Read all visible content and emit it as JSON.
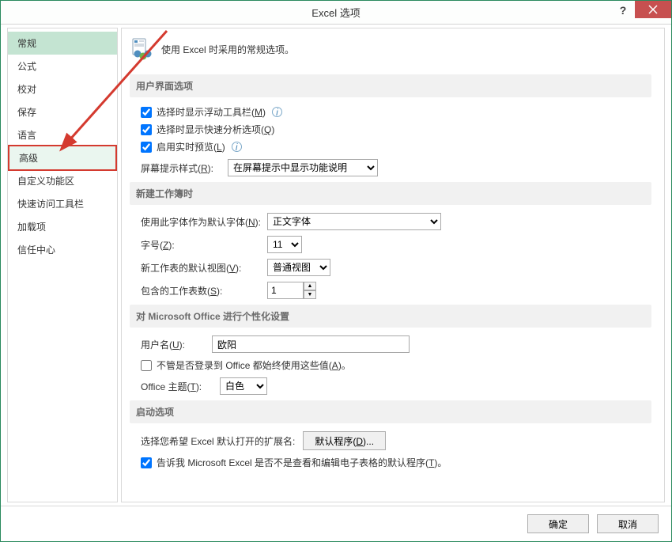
{
  "title": "Excel 选项",
  "sidebar": {
    "items": [
      {
        "label": "常规"
      },
      {
        "label": "公式"
      },
      {
        "label": "校对"
      },
      {
        "label": "保存"
      },
      {
        "label": "语言"
      },
      {
        "label": "高级"
      },
      {
        "label": "自定义功能区"
      },
      {
        "label": "快速访问工具栏"
      },
      {
        "label": "加载项"
      },
      {
        "label": "信任中心"
      }
    ],
    "selected_index": 0,
    "highlight_index": 5
  },
  "intro": {
    "text": "使用 Excel 时采用的常规选项。"
  },
  "sections": {
    "ui": {
      "title": "用户界面选项",
      "chk_minitoolbar": {
        "checked": true,
        "label": "选择时显示浮动工具栏(",
        "hotkey": "M",
        "tail": ")"
      },
      "chk_quick": {
        "checked": true,
        "label": "选择时显示快速分析选项(",
        "hotkey": "Q",
        "tail": ")"
      },
      "chk_livepreview": {
        "checked": true,
        "label": "启用实时预览(",
        "hotkey": "L",
        "tail": ")"
      },
      "screentip_label": "屏幕提示样式(",
      "screentip_hotkey": "R",
      "screentip_tail": "):",
      "screentip_value": "在屏幕提示中显示功能说明"
    },
    "newwb": {
      "title": "新建工作簿时",
      "font_label": "使用此字体作为默认字体(",
      "font_hotkey": "N",
      "font_tail": "):",
      "font_value": "正文字体",
      "size_label": "字号(",
      "size_hotkey": "Z",
      "size_tail": "):",
      "size_value": "11",
      "view_label": "新工作表的默认视图(",
      "view_hotkey": "V",
      "view_tail": "):",
      "view_value": "普通视图",
      "sheets_label": "包含的工作表数(",
      "sheets_hotkey": "S",
      "sheets_tail": "):",
      "sheets_value": "1"
    },
    "personal": {
      "title": "对 Microsoft Office 进行个性化设置",
      "user_label": "用户名(",
      "user_hotkey": "U",
      "user_tail": "):",
      "user_value": "欧阳",
      "always_label": "不管是否登录到 Office 都始终使用这些值(",
      "always_hotkey": "A",
      "always_tail": ")。",
      "always_checked": false,
      "theme_label": "Office 主题(",
      "theme_hotkey": "T",
      "theme_tail": "):",
      "theme_value": "白色"
    },
    "startup": {
      "title": "启动选项",
      "ext_label": "选择您希望 Excel 默认打开的扩展名:",
      "ext_btn": "默认程序(",
      "ext_btn_hotkey": "D",
      "ext_btn_tail": ")...",
      "tell_checked": true,
      "tell_label": "告诉我 Microsoft Excel 是否不是查看和编辑电子表格的默认程序(",
      "tell_hotkey": "T",
      "tell_tail": ")。"
    }
  },
  "footer": {
    "ok": "确定",
    "cancel": "取消"
  }
}
